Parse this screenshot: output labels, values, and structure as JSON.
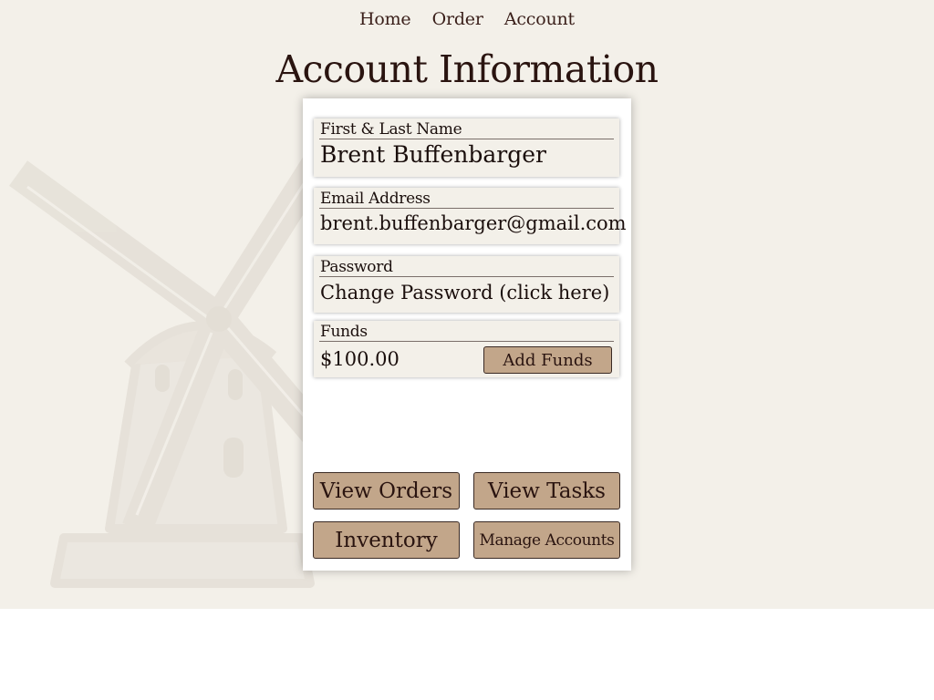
{
  "nav": {
    "home": "Home",
    "order": "Order",
    "account": "Account"
  },
  "page": {
    "title": "Account Information"
  },
  "account": {
    "name_label": "First & Last Name",
    "name_value": "Brent Buffenbarger",
    "email_label": "Email Address",
    "email_value": "brent.buffenbarger@gmail.com",
    "password_label": "Password",
    "password_value": "Change Password (click here)",
    "funds_label": "Funds",
    "funds_value": "$100.00",
    "add_funds_label": "Add Funds"
  },
  "actions": {
    "view_orders": "View Orders",
    "view_tasks": "View Tasks",
    "inventory": "Inventory",
    "manage_accounts": "Manage Accounts"
  },
  "colors": {
    "background": "#f3f0e9",
    "button": "#c2a68a",
    "text": "#2a1410"
  }
}
